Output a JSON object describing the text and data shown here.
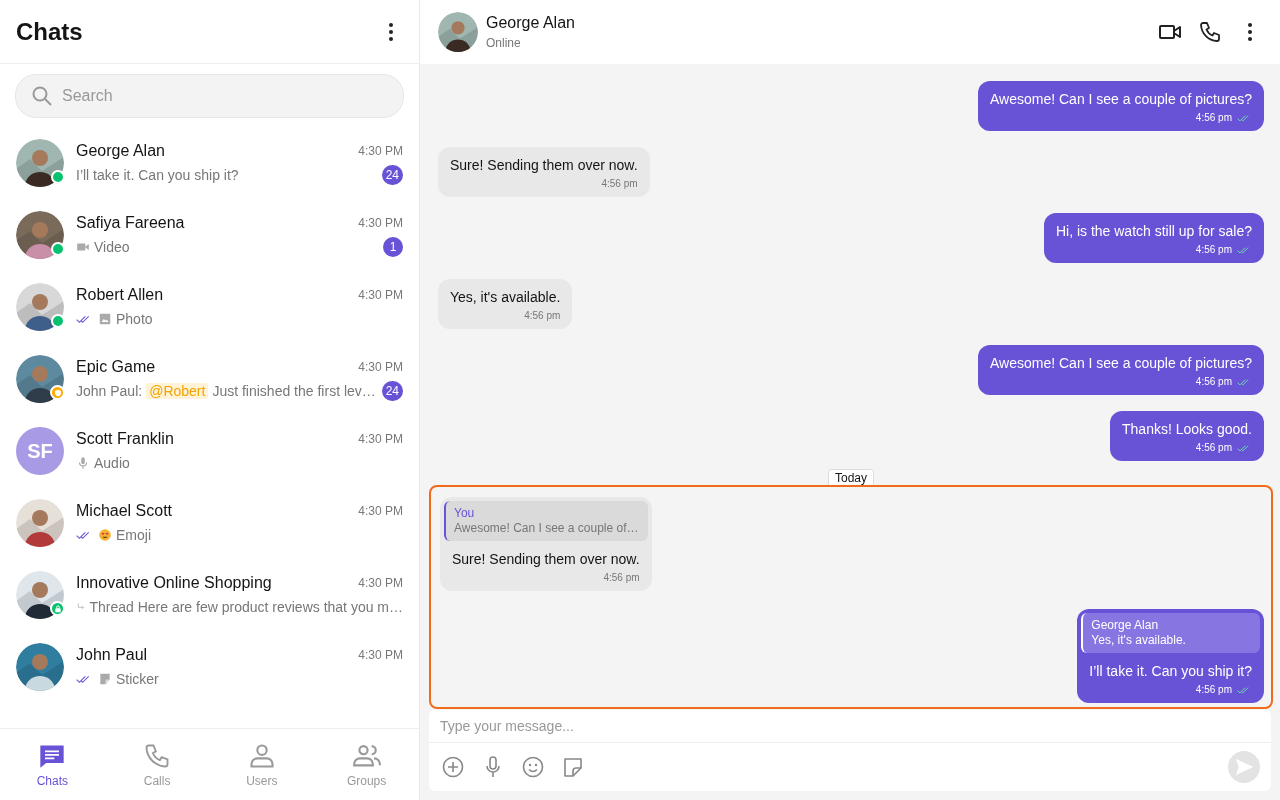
{
  "sidebar": {
    "title": "Chats",
    "search": {
      "placeholder": "Search"
    },
    "chats": [
      {
        "name": "George Alan",
        "time": "4:30 PM",
        "badge": {
          "kind": "online"
        },
        "preview": {
          "text": "I’ll take it. Can you ship it?"
        },
        "unread": "24"
      },
      {
        "name": "Safiya Fareena",
        "time": "4:30 PM",
        "badge": {
          "kind": "online"
        },
        "preview": {
          "kind": "video",
          "text": "Video"
        },
        "unread": "1"
      },
      {
        "name": "Robert Allen",
        "time": "4:30 PM",
        "badge": {
          "kind": "online"
        },
        "preview": {
          "ticks": true,
          "text": "Photo"
        }
      },
      {
        "name": "Epic Game",
        "time": "4:30 PM",
        "badge": {
          "kind": "group"
        },
        "preview": {
          "sender": "John Paul:",
          "mention": "@Robert",
          "text": "Just finished the first lev…"
        },
        "unread": "24"
      },
      {
        "name": "Scott Franklin",
        "time": "4:30 PM",
        "avatar": {
          "kind": "initials",
          "initials": "SF"
        },
        "preview": {
          "kind": "audio",
          "text": "Audio"
        }
      },
      {
        "name": "Michael Scott",
        "time": "4:30 PM",
        "preview": {
          "ticks": true,
          "kind": "emoji",
          "text": "Emoji"
        }
      },
      {
        "name": "Innovative Online Shopping",
        "time": "4:30 PM",
        "badge": {
          "kind": "private"
        },
        "preview": {
          "kind": "thread",
          "text": "Thread Here are few product reviews that you m…"
        }
      },
      {
        "name": "John Paul",
        "time": "4:30 PM",
        "preview": {
          "ticks": true,
          "kind": "sticker",
          "text": "Sticker"
        }
      }
    ],
    "nav": [
      {
        "label": "Chats",
        "selected": true
      },
      {
        "label": "Calls",
        "selected": false
      },
      {
        "label": "Users",
        "selected": false
      },
      {
        "label": "Groups",
        "selected": false
      }
    ]
  },
  "conversation": {
    "header": {
      "name": "George Alan",
      "status": "Online"
    },
    "earlier_messages": [
      {
        "kind": "outgoing",
        "text": "Awesome! Can I see a couple of pictures?",
        "time": "4:56 pm",
        "read": true
      },
      {
        "kind": "incoming",
        "text": "Sure! Sending them over now.",
        "time": "4:56 pm"
      },
      {
        "kind": "outgoing",
        "text": "Hi, is the watch still up for sale?",
        "time": "4:56 pm",
        "read": true
      },
      {
        "kind": "incoming",
        "text": "Yes, it's available.",
        "time": "4:56 pm"
      },
      {
        "kind": "outgoing",
        "text": "Awesome! Can I see a couple of pictures?",
        "time": "4:56 pm",
        "read": true
      },
      {
        "kind": "outgoing",
        "text": "Thanks! Looks good.",
        "time": "4:56 pm",
        "read": true
      }
    ],
    "date_separator": "Today",
    "today": {
      "highlighted": true,
      "messages": [
        {
          "kind": "incoming",
          "reply": {
            "author": "You",
            "text": "Awesome! Can I see a couple of…"
          },
          "text": "Sure! Sending them over now.",
          "time": "4:56 pm"
        },
        {
          "kind": "outgoing",
          "reply": {
            "author": "George Alan",
            "text": "Yes, it's available."
          },
          "text": "I’ll take it. Can you ship it?",
          "time": "4:56 pm",
          "read": true
        }
      ]
    },
    "composer": {
      "placeholder": "Type your message..."
    }
  }
}
